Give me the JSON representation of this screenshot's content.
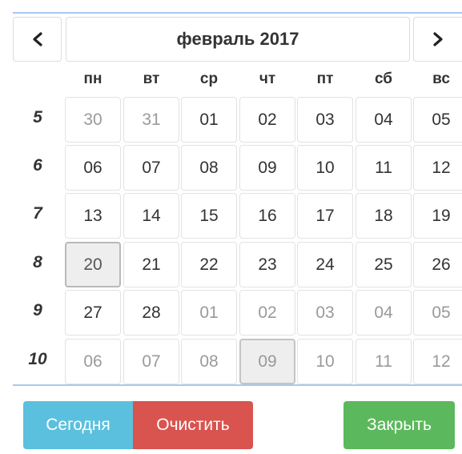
{
  "header": {
    "month_label": "февраль 2017"
  },
  "icons": {
    "prev": "chevron-left-icon",
    "next": "chevron-right-icon"
  },
  "weekdays": [
    "пн",
    "вт",
    "ср",
    "чт",
    "пт",
    "сб",
    "вс"
  ],
  "weeks": [
    {
      "number": "5",
      "days": [
        {
          "label": "30",
          "muted": true
        },
        {
          "label": "31",
          "muted": true
        },
        {
          "label": "01"
        },
        {
          "label": "02"
        },
        {
          "label": "03"
        },
        {
          "label": "04"
        },
        {
          "label": "05"
        }
      ]
    },
    {
      "number": "6",
      "days": [
        {
          "label": "06"
        },
        {
          "label": "07"
        },
        {
          "label": "08"
        },
        {
          "label": "09"
        },
        {
          "label": "10"
        },
        {
          "label": "11"
        },
        {
          "label": "12"
        }
      ]
    },
    {
      "number": "7",
      "days": [
        {
          "label": "13"
        },
        {
          "label": "14"
        },
        {
          "label": "15"
        },
        {
          "label": "16"
        },
        {
          "label": "17"
        },
        {
          "label": "18"
        },
        {
          "label": "19"
        }
      ]
    },
    {
      "number": "8",
      "days": [
        {
          "label": "20",
          "selected": true
        },
        {
          "label": "21"
        },
        {
          "label": "22"
        },
        {
          "label": "23"
        },
        {
          "label": "24"
        },
        {
          "label": "25"
        },
        {
          "label": "26"
        }
      ]
    },
    {
      "number": "9",
      "days": [
        {
          "label": "27"
        },
        {
          "label": "28"
        },
        {
          "label": "01",
          "muted": true
        },
        {
          "label": "02",
          "muted": true
        },
        {
          "label": "03",
          "muted": true
        },
        {
          "label": "04",
          "muted": true
        },
        {
          "label": "05",
          "muted": true
        }
      ]
    },
    {
      "number": "10",
      "days": [
        {
          "label": "06",
          "muted": true
        },
        {
          "label": "07",
          "muted": true
        },
        {
          "label": "08",
          "muted": true
        },
        {
          "label": "09",
          "muted": true,
          "today": true
        },
        {
          "label": "10",
          "muted": true
        },
        {
          "label": "11",
          "muted": true
        },
        {
          "label": "12",
          "muted": true
        }
      ]
    }
  ],
  "buttons": {
    "today": "Сегодня",
    "clear": "Очистить",
    "close": "Закрыть"
  },
  "colors": {
    "today_button": "#5bc0de",
    "clear_button": "#d9534f",
    "close_button": "#5cb85c",
    "accent_rule": "#a9c8ee"
  }
}
